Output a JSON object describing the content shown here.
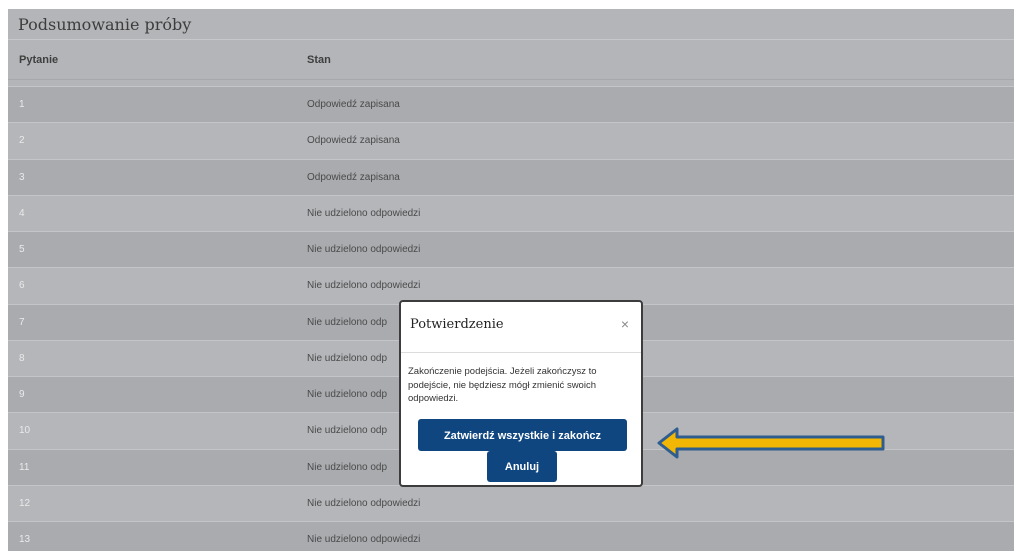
{
  "summary": {
    "title": "Podsumowanie próby",
    "columns": {
      "question": "Pytanie",
      "status": "Stan"
    },
    "rows": [
      {
        "question": "1",
        "status": "Odpowiedź zapisana"
      },
      {
        "question": "2",
        "status": "Odpowiedź zapisana"
      },
      {
        "question": "3",
        "status": "Odpowiedź zapisana"
      },
      {
        "question": "4",
        "status": "Nie udzielono odpowiedzi"
      },
      {
        "question": "5",
        "status": "Nie udzielono odpowiedzi"
      },
      {
        "question": "6",
        "status": "Nie udzielono odpowiedzi"
      },
      {
        "question": "7",
        "status": "Nie udzielono odp"
      },
      {
        "question": "8",
        "status": "Nie udzielono odp"
      },
      {
        "question": "9",
        "status": "Nie udzielono odp"
      },
      {
        "question": "10",
        "status": "Nie udzielono odp"
      },
      {
        "question": "11",
        "status": "Nie udzielono odp"
      },
      {
        "question": "12",
        "status": "Nie udzielono odpowiedzi"
      },
      {
        "question": "13",
        "status": "Nie udzielono odpowiedzi"
      }
    ]
  },
  "modal": {
    "title": "Potwierdzenie",
    "close_glyph": "×",
    "message": "Zakończenie podejścia. Jeżeli zakończysz to podejście, nie będziesz mógł zmienić swoich odpowiedzi.",
    "confirm_label": "Zatwierdź wszystkie i zakończ",
    "cancel_label": "Anuluj"
  },
  "colors": {
    "button": "#0f4680",
    "arrow_fill": "#f2b705",
    "arrow_outline": "#2f5d8f"
  }
}
